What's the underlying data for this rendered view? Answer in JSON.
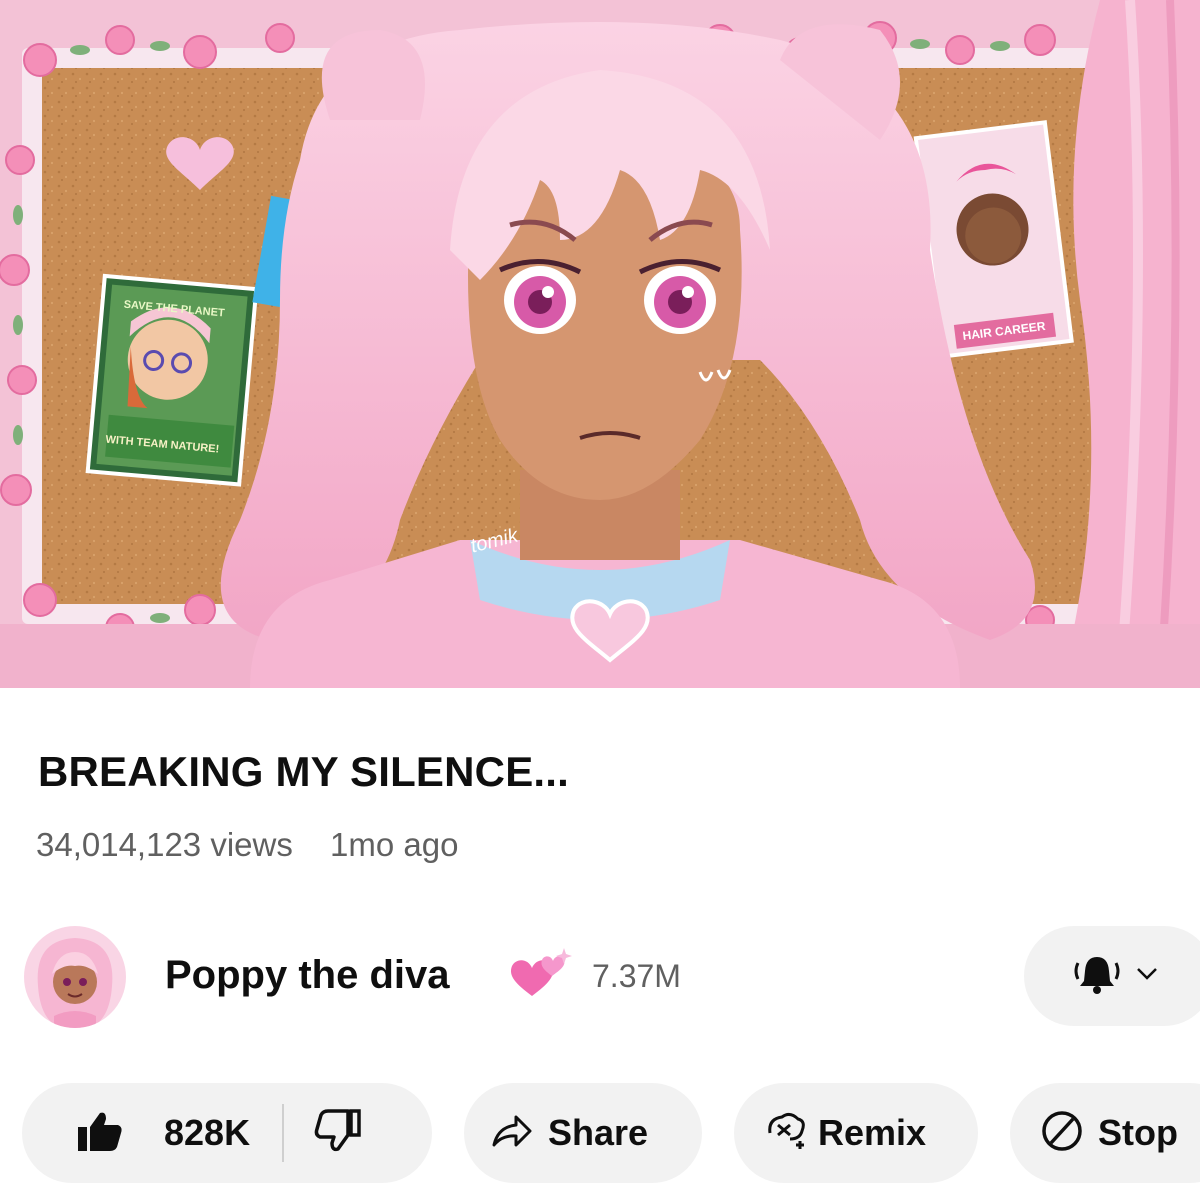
{
  "thumbnail": {
    "watermark": "tomik",
    "poster_left": {
      "top_text": "SAVE THE PLANET",
      "bottom_text": "WITH TEAM NATURE!"
    },
    "poster_right": {
      "bottom_text": "HAIR CAREER"
    }
  },
  "video": {
    "title": "BREAKING MY SILENCE...",
    "views": "34,014,123 views",
    "age": "1mo ago"
  },
  "channel": {
    "name": "Poppy the diva",
    "subscribers": "7.37M",
    "name_emoji_icon": "sparkling-hearts-icon",
    "notification_icon": "bell-ringing-icon"
  },
  "actions": {
    "likes": "828K",
    "share_label": "Share",
    "remix_label": "Remix",
    "stop_label": "Stop"
  },
  "colors": {
    "accent_pink": "#f4a7c8",
    "pill_background": "#f2f2f2",
    "secondary_text": "#606060"
  }
}
